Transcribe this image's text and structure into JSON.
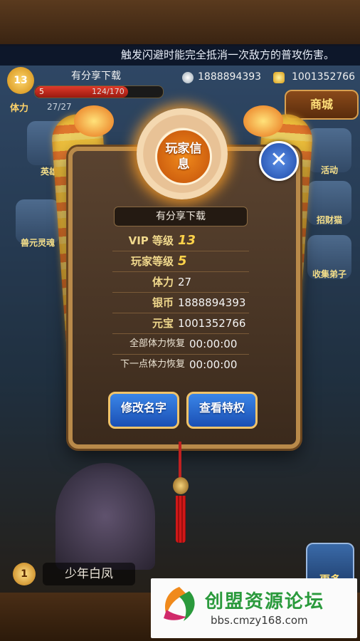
{
  "marquee": "触发闪避时能完全抵消一次敌方的普攻伤害。",
  "hud": {
    "level": "13",
    "name": "有分享下载",
    "exp_text": "124/170",
    "exp_fraction": 0.73,
    "exp_level_badge": "5",
    "stamina_label": "体力",
    "stamina_value": "27/27",
    "silver": "1888894393",
    "gold": "1001352766",
    "shop_label": "商城"
  },
  "side_left": [
    {
      "label": "英雄"
    },
    {
      "label": "兽元灵魂"
    }
  ],
  "side_right": [
    {
      "label": "活动"
    },
    {
      "label": "招财猫"
    },
    {
      "label": "收集弟子"
    }
  ],
  "panel": {
    "emblem_title": "玩家信息",
    "player_name": "有分享下载",
    "rows": [
      {
        "label": "VIP 等级",
        "value": "13"
      },
      {
        "label": "玩家等级",
        "value": "5"
      },
      {
        "label": "体力",
        "value": "27"
      },
      {
        "label": "银币",
        "value": "1888894393"
      },
      {
        "label": "元宝",
        "value": "1001352766"
      },
      {
        "label": "全部体力恢复",
        "value": "00:00:00"
      },
      {
        "label": "下一点体力恢复",
        "value": "00:00:00"
      }
    ],
    "rename_button": "修改名字",
    "privilege_button": "查看特权",
    "close_symbol": "✕"
  },
  "bottom": {
    "level": "1",
    "character_name": "少年白凤",
    "more_label": "更多"
  },
  "watermark": {
    "title": "创盟资源论坛",
    "url": "bbs.cmzy168.com"
  },
  "colors": {
    "accent_gold": "#f0d88c",
    "button_blue": "#1a4fb4",
    "emblem_orange": "#f08a1c"
  }
}
